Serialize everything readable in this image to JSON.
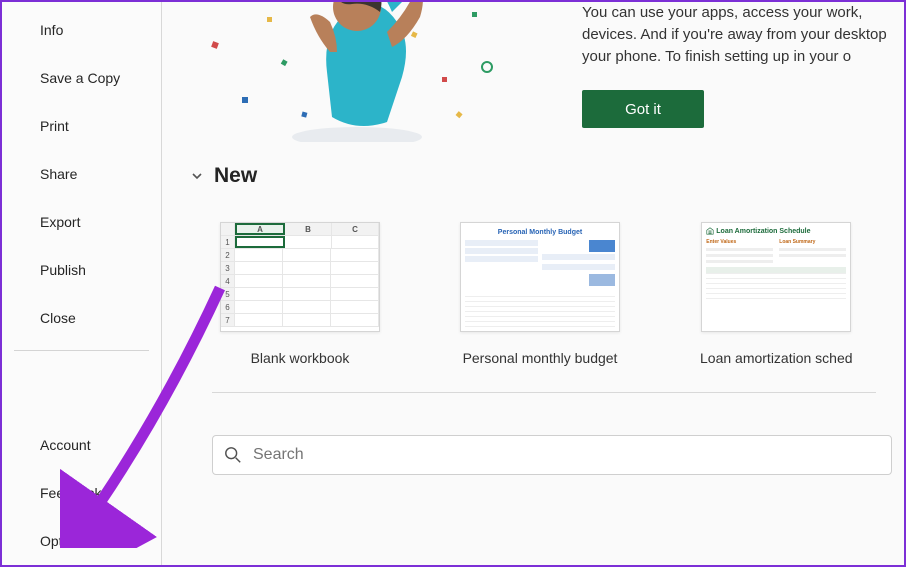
{
  "sidebar": {
    "items": [
      {
        "label": "Info"
      },
      {
        "label": "Save a Copy"
      },
      {
        "label": "Print"
      },
      {
        "label": "Share"
      },
      {
        "label": "Export"
      },
      {
        "label": "Publish"
      },
      {
        "label": "Close"
      }
    ],
    "bottom_items": [
      {
        "label": "Account"
      },
      {
        "label": "Feedback"
      },
      {
        "label": "Options"
      }
    ]
  },
  "banner": {
    "text": "You can use your apps, access your work, devices. And if you're away from your desktop your phone. To finish setting up in your o",
    "button": "Got it"
  },
  "new_section": {
    "title": "New",
    "templates": [
      {
        "label": "Blank workbook",
        "thumb_title": "",
        "cols": [
          "A",
          "B",
          "C"
        ],
        "rows": [
          "1",
          "2",
          "3",
          "4",
          "5",
          "6",
          "7"
        ]
      },
      {
        "label": "Personal monthly budget",
        "thumb_title": "Personal Monthly Budget"
      },
      {
        "label": "Loan amortization sched",
        "thumb_title": "Loan Amortization Schedule",
        "col1_title": "Enter Values",
        "col2_title": "Loan Summary"
      }
    ]
  },
  "search": {
    "placeholder": "Search"
  },
  "colors": {
    "accent": "#1c6b3b",
    "annotation": "#9b26d9"
  }
}
